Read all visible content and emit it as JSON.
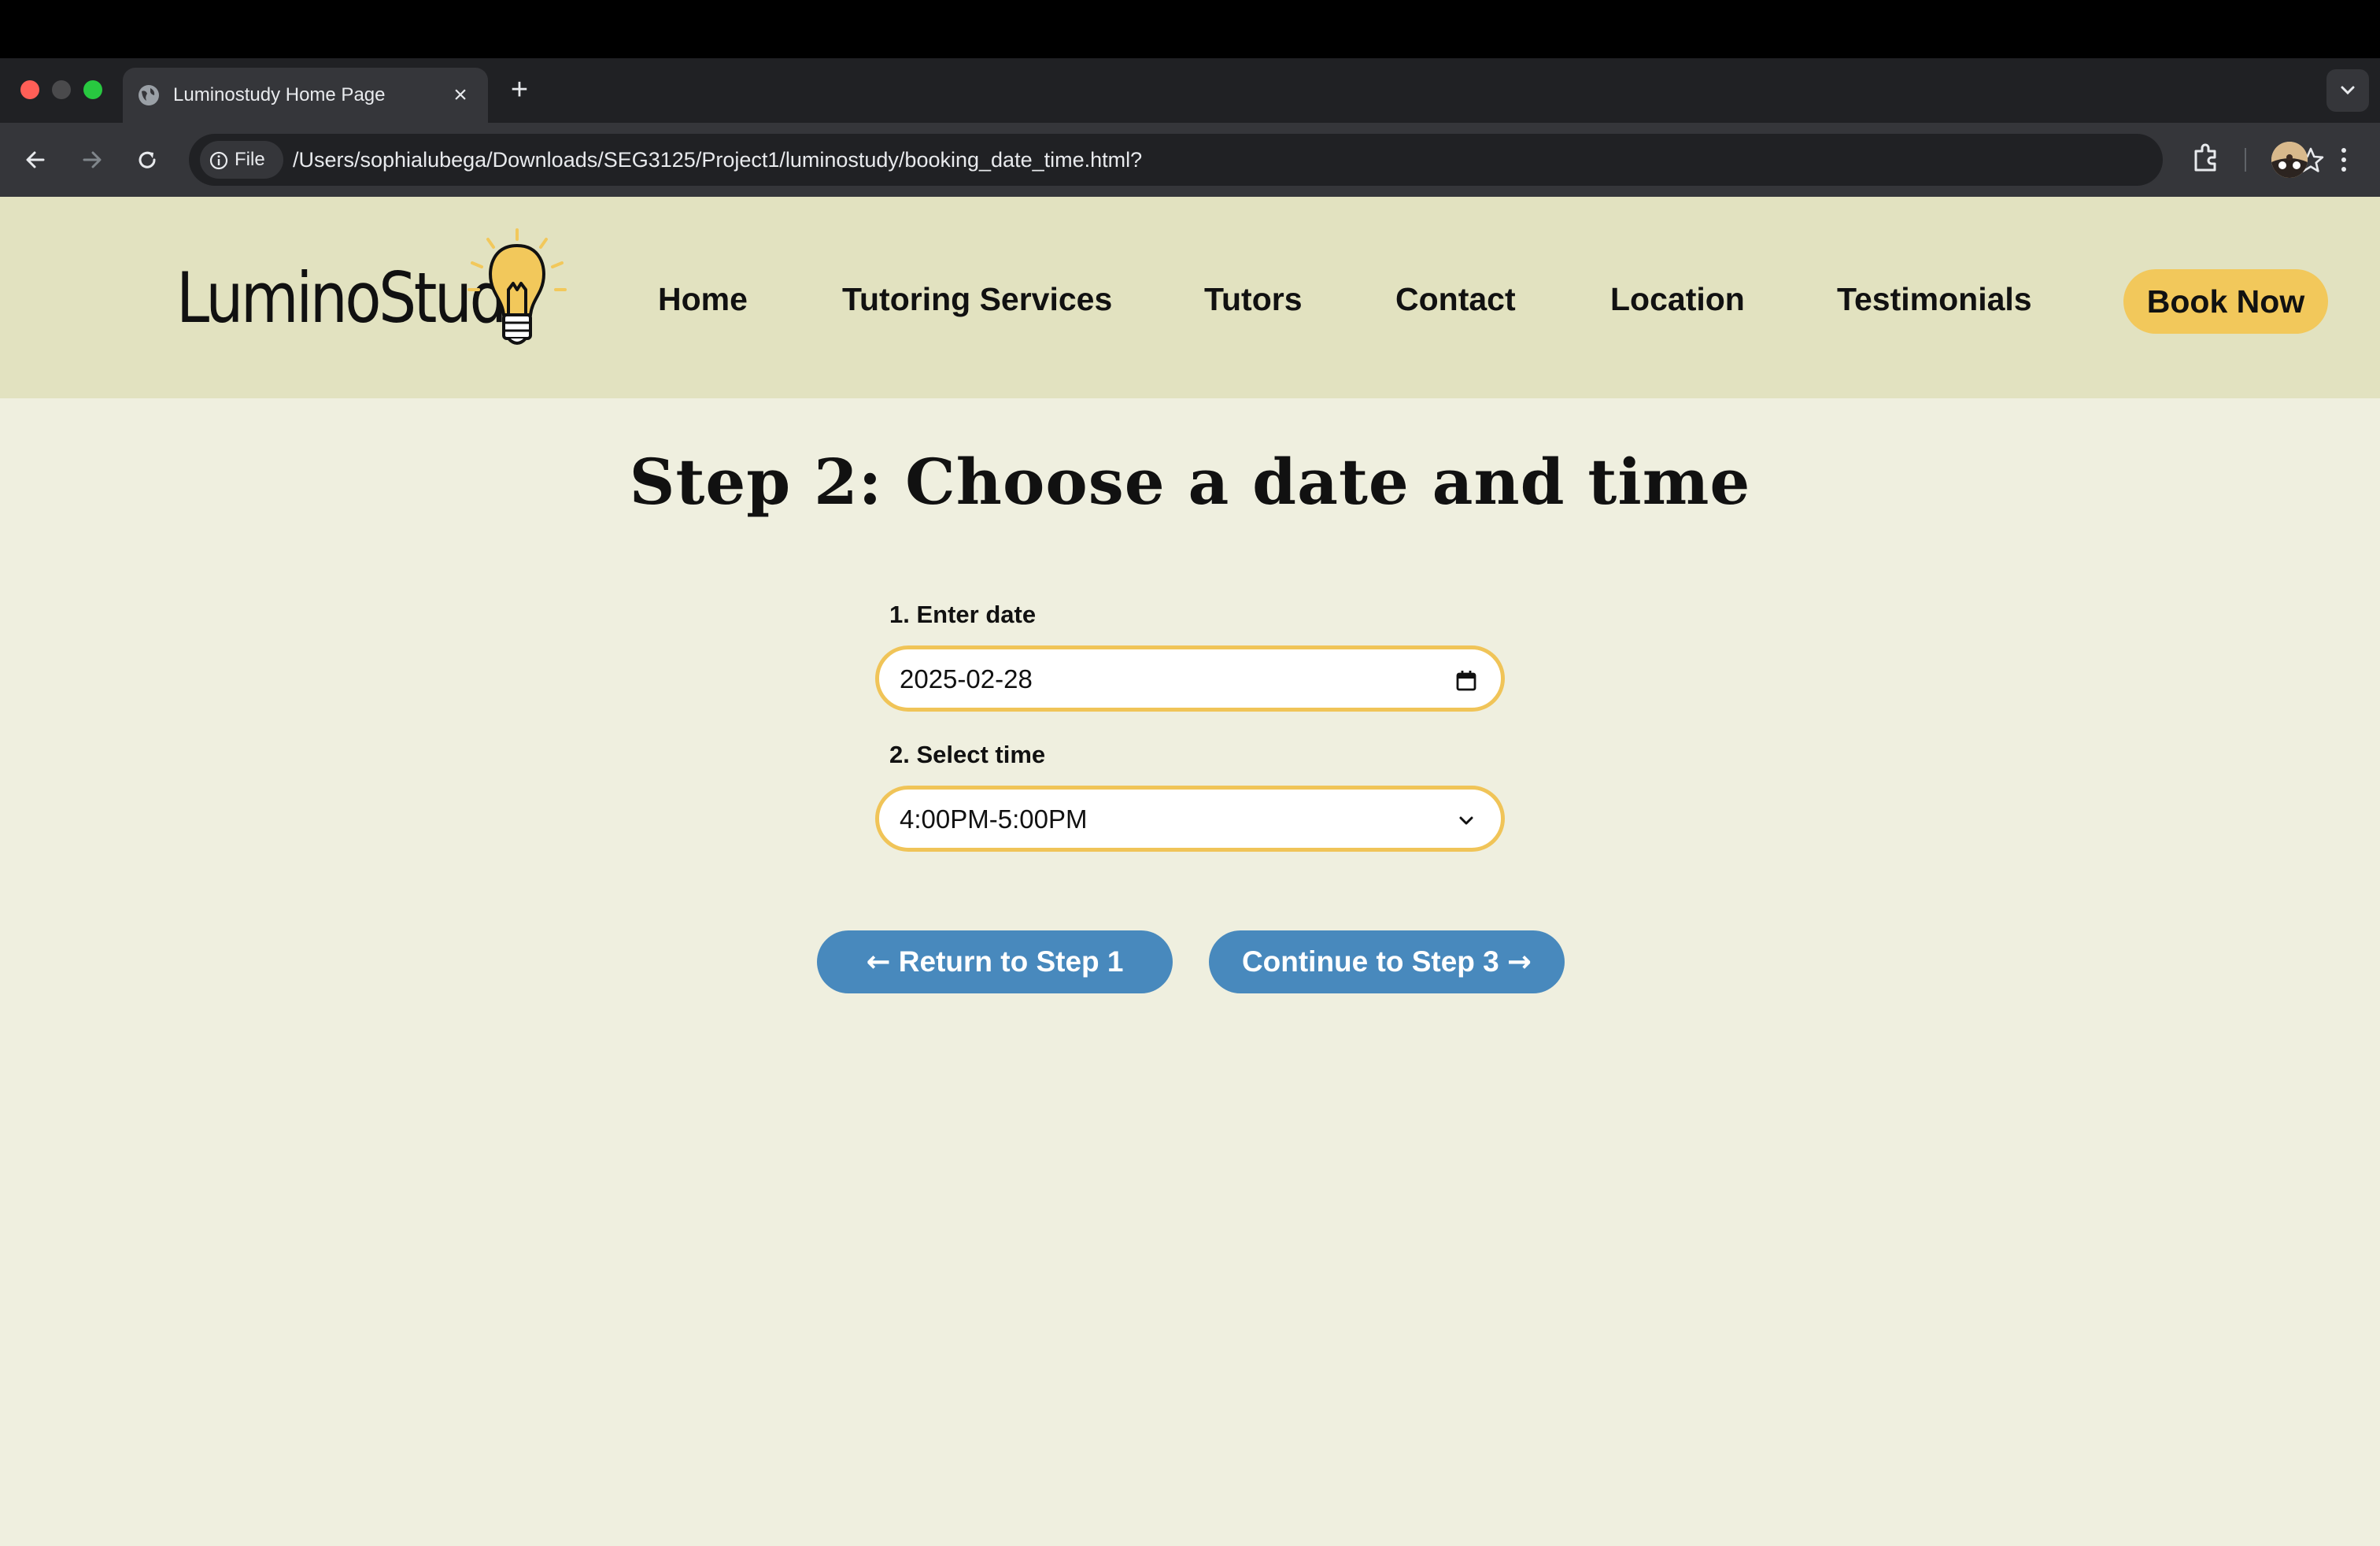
{
  "browser": {
    "tab_title": "Luminostudy Home Page",
    "site_chip_label": "File",
    "url": "/Users/sophialubega/Downloads/SEG3125/Project1/luminostudy/booking_date_time.html?"
  },
  "header": {
    "logo_text": "LuminoStudy",
    "nav": [
      "Home",
      "Tutoring Services",
      "Tutors",
      "Contact",
      "Location",
      "Testimonials"
    ],
    "cta_label": "Book Now",
    "cta_color": "#f2c85b"
  },
  "main": {
    "title": "Step 2: Choose a date and time",
    "date_label": "1. Enter date",
    "date_value": "2025-02-28",
    "time_label": "2. Select time",
    "time_value": "4:00PM-5:00PM",
    "back_button": "Return to Step 1",
    "next_button": "Continue to Step 3",
    "field_border_color": "#f0c458",
    "button_color": "#4889bd"
  }
}
